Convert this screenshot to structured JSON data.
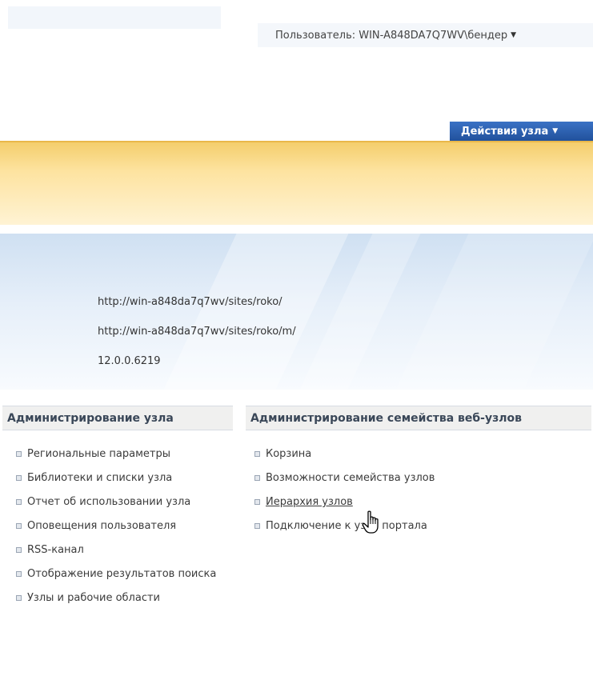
{
  "header": {
    "user_label": "Пользователь: WIN-A848DA7Q7WV\\бендер",
    "site_actions_label": "Действия узла"
  },
  "site_info": {
    "site_url": "http://win-a848da7q7wv/sites/roko/",
    "mobile_url": "http://win-a848da7q7wv/sites/roko/m/",
    "version": "12.0.0.6219"
  },
  "site_admin": {
    "heading": "Администрирование узла",
    "links": [
      "Региональные параметры",
      "Библиотеки и списки узла",
      "Отчет об использовании узла",
      "Оповещения пользователя",
      "RSS-канал",
      "Отображение результатов поиска",
      "Узлы и рабочие области"
    ]
  },
  "collection_admin": {
    "heading": "Администрирование семейства веб-узлов",
    "links": [
      "Корзина",
      "Возможности семейства узлов",
      "Иерархия узлов",
      "Подключение к узлу портала"
    ]
  },
  "colors": {
    "site_actions_bg": "#2e63b3",
    "orange_band": "#f4ce6c",
    "blue_band": "#cfe0f2"
  }
}
